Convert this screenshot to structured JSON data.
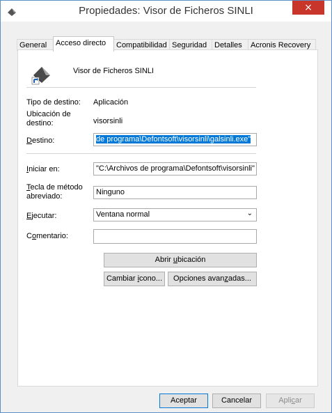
{
  "window": {
    "title": "Propiedades: Visor de Ficheros SINLI",
    "close_label": "×"
  },
  "tabs": [
    {
      "label": "General"
    },
    {
      "label": "Acceso directo"
    },
    {
      "label": "Compatibilidad"
    },
    {
      "label": "Seguridad"
    },
    {
      "label": "Detalles"
    },
    {
      "label": "Acronis Recovery"
    }
  ],
  "active_tab": "Acceso directo",
  "shortcut": {
    "name": "Visor de Ficheros SINLI"
  },
  "fields": {
    "tipo_label": "Tipo de destino:",
    "tipo_value": "Aplicación",
    "ubicacion_label_1": "Ubicación de",
    "ubicacion_label_2": "destino:",
    "ubicacion_value": "visorsinli",
    "destino_label": "Destino:",
    "destino_value": "de programa\\Defontsoft\\visorsinli\\galsinli.exe\"",
    "iniciar_label": "Iniciar en:",
    "iniciar_value": "\"C:\\Archivos de programa\\Defontsoft\\visorsinli\"",
    "tecla_label_1": "Tecla de método",
    "tecla_label_2": "abreviado:",
    "tecla_value": "Ninguno",
    "ejecutar_label": "Ejecutar:",
    "ejecutar_value": "Ventana normal",
    "comentario_label": "Comentario:",
    "comentario_value": ""
  },
  "buttons": {
    "abrir_ubicacion": "Abrir ubicación",
    "cambiar_icono": "Cambiar icono...",
    "opciones_avanzadas": "Opciones avanzadas...",
    "aceptar": "Aceptar",
    "cancelar": "Cancelar",
    "aplicar": "Aplicar"
  },
  "colors": {
    "selection": "#0078d7",
    "close": "#c7352b",
    "border": "#5a8fc7"
  }
}
